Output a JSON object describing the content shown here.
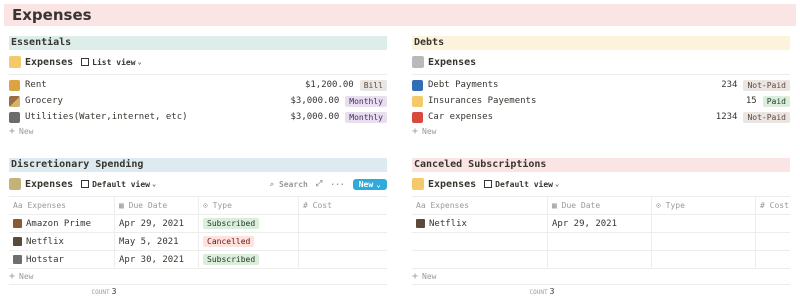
{
  "page": {
    "title": "Expenses"
  },
  "essentials": {
    "heading": "Essentials",
    "db_title": "Expenses",
    "view": "List view",
    "items": [
      {
        "icon": "money-bag-icon",
        "label": "Rent",
        "amount": "$1,200.00",
        "tag": "Bill"
      },
      {
        "icon": "broom-icon",
        "label": "Grocery",
        "amount": "$3,000.00",
        "tag": "Monthly"
      },
      {
        "icon": "printer-icon",
        "label": "Utilities(Water,internet, etc)",
        "amount": "$3,000.00",
        "tag": "Monthly"
      }
    ],
    "new_label": "New"
  },
  "debts": {
    "heading": "Debts",
    "db_title": "Expenses",
    "items": [
      {
        "icon": "atm-icon",
        "label": "Debt Payments",
        "amount": "234",
        "tag": "Not-Paid"
      },
      {
        "icon": "money-with-wings-icon",
        "label": "Insurances Payements",
        "amount": "15",
        "tag": "Paid"
      },
      {
        "icon": "car-icon",
        "label": "Car expenses",
        "amount": "1234",
        "tag": "Not-Paid"
      }
    ],
    "new_label": "New"
  },
  "discretionary": {
    "heading": "Discretionary Spending",
    "db_title": "Expenses",
    "view": "Default view",
    "search": "Search",
    "new_button": "New",
    "columns": [
      "Expenses",
      "Due Date",
      "Type",
      "Cost"
    ],
    "rows": [
      {
        "icon": "tv-icon",
        "name": "Amazon Prime",
        "due": "Apr 29, 2021",
        "type": "Subscribed",
        "cost": ""
      },
      {
        "icon": "tv-icon",
        "name": "Netflix",
        "due": "May 5, 2021",
        "type": "Cancelled",
        "cost": ""
      },
      {
        "icon": "camera-icon",
        "name": "Hotstar",
        "due": "Apr 30, 2021",
        "type": "Subscribed",
        "cost": ""
      }
    ],
    "new_label": "New",
    "count_label": "COUNT",
    "count": "3"
  },
  "canceled": {
    "heading": "Canceled Subscriptions",
    "db_title": "Expenses",
    "view": "Default view",
    "columns": [
      "Expenses",
      "Due Date",
      "Type",
      "Cost"
    ],
    "rows": [
      {
        "icon": "tv-icon",
        "name": "Netflix",
        "due": "Apr 29, 2021",
        "type": "",
        "cost": ""
      }
    ],
    "new_label": "New",
    "count_label": "COUNT",
    "count": "3"
  },
  "colors": {
    "accent": "#2eaadc",
    "title_bg": "#fbe4e4",
    "essentials_bg": "#ddedea",
    "debts_bg": "#fbf3db",
    "discretionary_bg": "#ddebf1",
    "canceled_bg": "#fbe4e4"
  }
}
